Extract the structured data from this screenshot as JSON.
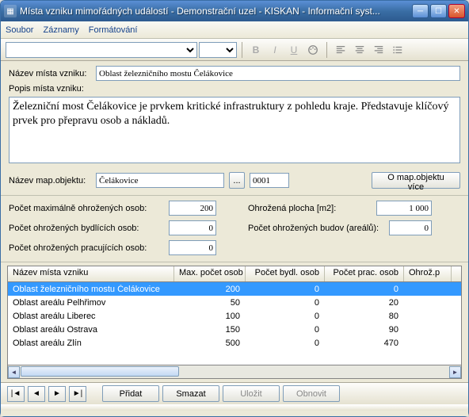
{
  "window": {
    "title": "Místa vzniku mimořádných událostí - Demonstrační uzel - KISKAN - Informační syst..."
  },
  "menu": {
    "file": "Soubor",
    "records": "Záznamy",
    "format": "Formátování"
  },
  "toolbar": {
    "font_name": "",
    "font_size": ""
  },
  "form": {
    "name_label": "Název místa vzniku:",
    "name_value": "Oblast železničního mostu Čelákovice",
    "desc_label": "Popis místa vzniku:",
    "desc_value": "Železniční most Čelákovice je prvkem kritické infrastruktury z pohledu kraje. Představuje klíčový prvek pro přepravu osob a nákladů.",
    "mapobj_label": "Název map.objektu:",
    "mapobj_value": "Čelákovice",
    "mapobj_code": "0001",
    "mapobj_more": "O map.objektu více"
  },
  "stats": {
    "max_persons_label": "Počet maximálně ohrožených osob:",
    "max_persons_value": "200",
    "living_label": "Počet ohrožených bydlících osob:",
    "living_value": "0",
    "working_label": "Počet ohrožených pracujících osob:",
    "working_value": "0",
    "area_label": "Ohrožená plocha [m2]:",
    "area_value": "1 000",
    "buildings_label": "Počet ohrožených budov (areálů):",
    "buildings_value": "0"
  },
  "grid": {
    "headers": {
      "name": "Název místa vzniku",
      "max": "Max. počet osob",
      "living": "Počet bydl. osob",
      "working": "Počet prac. osob",
      "area": "Ohrož.p"
    },
    "rows": [
      {
        "name": "Oblast železničního mostu Čelákovice",
        "max": "200",
        "living": "0",
        "working": "0"
      },
      {
        "name": "Oblast areálu Pelhřimov",
        "max": "50",
        "living": "0",
        "working": "20"
      },
      {
        "name": "Oblast areálu Liberec",
        "max": "100",
        "living": "0",
        "working": "80"
      },
      {
        "name": "Oblast areálu Ostrava",
        "max": "150",
        "living": "0",
        "working": "90"
      },
      {
        "name": "Oblast areálu Zlín",
        "max": "500",
        "living": "0",
        "working": "470"
      }
    ]
  },
  "nav": {
    "add": "Přidat",
    "delete": "Smazat",
    "save": "Uložit",
    "refresh": "Obnovit"
  }
}
